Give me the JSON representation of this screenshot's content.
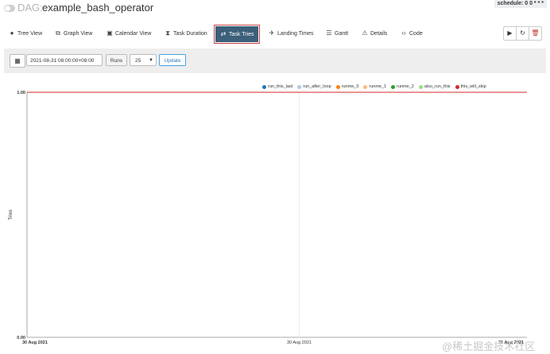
{
  "header": {
    "dag_prefix": "DAG:",
    "dag_name": "example_bash_operator",
    "schedule": "schedule: 0 0 * * *"
  },
  "nav": {
    "tabs": [
      {
        "label": "Tree View",
        "icon": "tree-icon"
      },
      {
        "label": "Graph View",
        "icon": "graph-icon"
      },
      {
        "label": "Calendar View",
        "icon": "calendar-icon"
      },
      {
        "label": "Task Duration",
        "icon": "hourglass-icon"
      },
      {
        "label": "Task Tries",
        "icon": "retry-icon",
        "active": true
      },
      {
        "label": "Landing Times",
        "icon": "landing-icon"
      },
      {
        "label": "Gantt",
        "icon": "gantt-icon"
      },
      {
        "label": "Details",
        "icon": "warning-icon"
      },
      {
        "label": "Code",
        "icon": "code-icon"
      }
    ],
    "actions": [
      {
        "icon": "play-icon"
      },
      {
        "icon": "refresh-icon"
      },
      {
        "icon": "trash-icon"
      }
    ]
  },
  "filters": {
    "base_date": "2021-08-31 08:00:00+08:00",
    "runs_label": "Runs",
    "runs_value": "25",
    "update_label": "Update"
  },
  "colors": {
    "active_tab": "#3c5f7a",
    "active_tab_border": "#c94444",
    "top_line": "#c0392b",
    "update_border": "#4aa0e0"
  },
  "chart_data": {
    "type": "line",
    "ylabel": "Tries",
    "ylim": [
      0,
      1
    ],
    "y_ticks": [
      "1.00",
      "0.00"
    ],
    "x_ticks": [
      "30 Aug 2021",
      "30 Aug 2021",
      "31 Aug 2021"
    ],
    "series": [
      {
        "name": "run_this_last",
        "color": "#1f77b4",
        "values": [
          1,
          1
        ]
      },
      {
        "name": "run_after_loop",
        "color": "#aec7e8",
        "values": [
          1,
          1
        ]
      },
      {
        "name": "runme_0",
        "color": "#ff7f0e",
        "values": [
          1,
          1
        ]
      },
      {
        "name": "runme_1",
        "color": "#ffbb78",
        "values": [
          1,
          1
        ]
      },
      {
        "name": "runme_2",
        "color": "#2ca02c",
        "values": [
          1,
          1
        ]
      },
      {
        "name": "also_run_this",
        "color": "#98df8a",
        "values": [
          1,
          1
        ]
      },
      {
        "name": "this_will_skip",
        "color": "#d62728",
        "values": [
          1,
          1
        ]
      }
    ]
  },
  "watermark": "@稀土掘金技术社区"
}
